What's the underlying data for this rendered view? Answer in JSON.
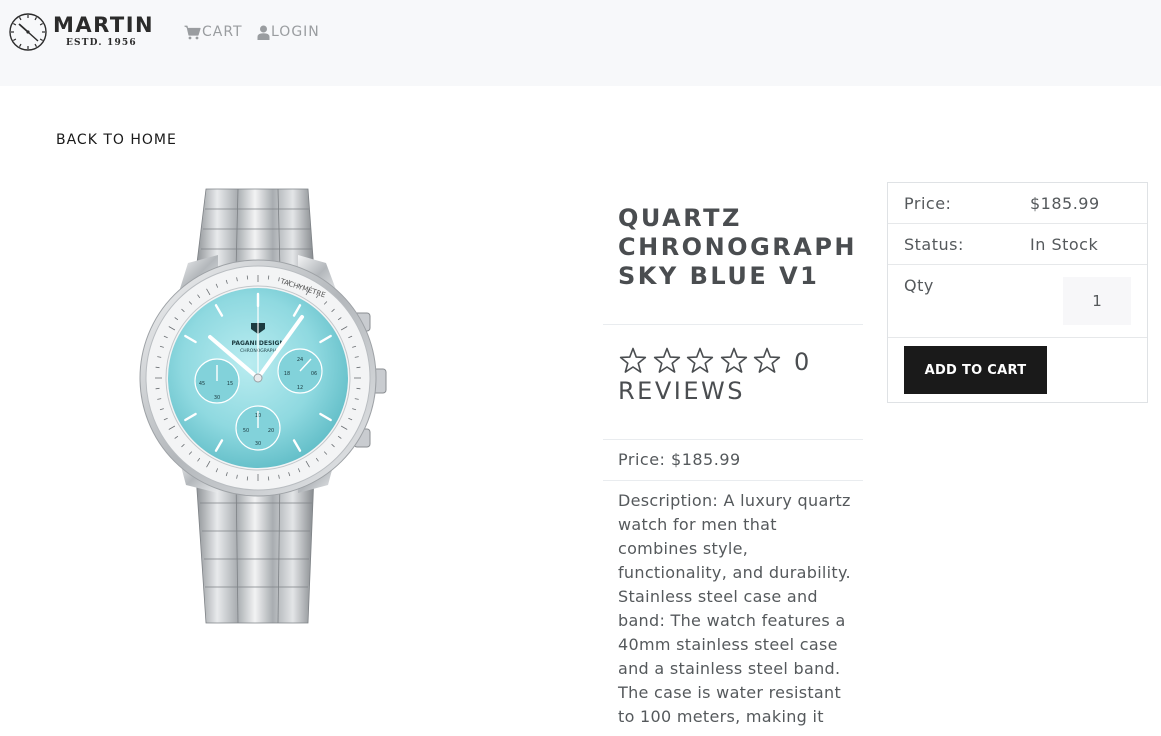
{
  "brand": {
    "name": "MARTIN",
    "estd": "ESTD. 1956"
  },
  "nav": {
    "cart_label": "CART",
    "login_label": "LOGIN"
  },
  "back_label": "BACK TO HOME",
  "product": {
    "title": "QUARTZ CHRONOGRAPH SKY BLUE V1",
    "rating": 0,
    "stars_total": 5,
    "reviews_count": "0",
    "reviews_label": "REVIEWS",
    "price_text": "Price: $185.99",
    "description": "Description: A luxury quartz watch for men that combines style, functionality, and durability. Stainless steel case and band: The watch features a 40mm stainless steel case and a stainless steel band. The case is water resistant to 100 meters, making it"
  },
  "cart_card": {
    "price_label": "Price:",
    "price_value": "$185.99",
    "status_label": "Status:",
    "status_value": "In Stock",
    "qty_label": "Qty",
    "qty_value": "1",
    "add_button": "ADD TO CART"
  },
  "watch_dial": {
    "brand_text": "PAGANI DESIGN",
    "sub_text": "CHRONOGRAPH",
    "bezel_label": "TACHYMÈTRE"
  },
  "colors": {
    "navbar_bg": "#f7f8fa",
    "button_bg": "#1a1a1a",
    "dial_blue": "#8fd9e0",
    "nav_text": "#9a9da0"
  },
  "icons": {
    "cart": "cart-icon",
    "login": "user-icon",
    "star": "star-outline-icon",
    "brand": "clock-logo-icon"
  }
}
